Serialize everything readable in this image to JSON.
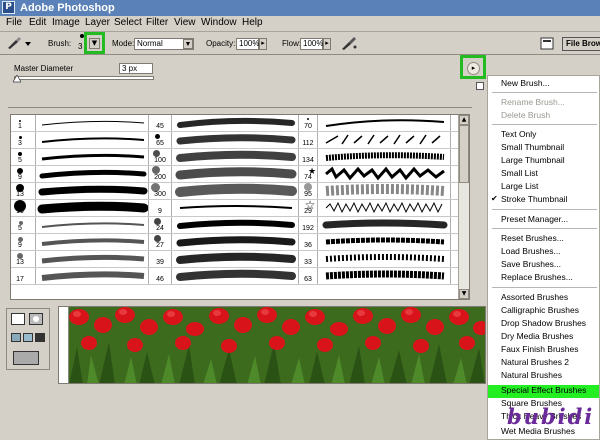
{
  "titlebar": {
    "title": "Adobe Photoshop",
    "app_icon": "ps-icon"
  },
  "menubar": {
    "items": [
      "File",
      "Edit",
      "Image",
      "Layer",
      "Select",
      "Filter",
      "View",
      "Window",
      "Help"
    ]
  },
  "options": {
    "brush_label": "Brush:",
    "brush_size": "3",
    "mode_label": "Mode:",
    "mode_value": "Normal",
    "opacity_label": "Opacity:",
    "opacity_value": "100%",
    "flow_label": "Flow:",
    "flow_value": "100%",
    "file_browser_label": "File Brow"
  },
  "picker": {
    "master_diameter_label": "Master Diameter",
    "master_diameter_value": "3 px",
    "master_diameter_fraction": 0.01
  },
  "brushes": {
    "rows": [
      {
        "a": "1",
        "b": "45",
        "c": "70"
      },
      {
        "a": "3",
        "b": "65",
        "c": "112"
      },
      {
        "a": "5",
        "b": "100",
        "c": "134"
      },
      {
        "a": "9",
        "b": "200",
        "c": "74"
      },
      {
        "a": "13",
        "b": "300",
        "c": "95"
      },
      {
        "a": "19",
        "b": "9",
        "c": "29"
      },
      {
        "a": "5",
        "b": "24",
        "c": "192"
      },
      {
        "a": "9",
        "b": "27",
        "c": "36"
      },
      {
        "a": "13",
        "b": "39",
        "c": "33"
      },
      {
        "a": "17",
        "b": "46",
        "c": "63"
      }
    ]
  },
  "context_menu": {
    "new_brush": "New Brush...",
    "rename_brush": "Rename Brush...",
    "delete_brush": "Delete Brush",
    "text_only": "Text Only",
    "small_thumbnail": "Small Thumbnail",
    "large_thumbnail": "Large Thumbnail",
    "small_list": "Small List",
    "large_list": "Large List",
    "stroke_thumbnail": "Stroke Thumbnail",
    "checkmark": "✔",
    "preset_manager": "Preset Manager...",
    "reset_brushes": "Reset Brushes...",
    "load_brushes": "Load Brushes...",
    "save_brushes": "Save Brushes...",
    "replace_brushes": "Replace Brushes...",
    "assorted": "Assorted Brushes",
    "calligraphic": "Calligraphic Brushes",
    "drop_shadow": "Drop Shadow Brushes",
    "dry_media": "Dry Media Brushes",
    "faux_finish": "Faux Finish Brushes",
    "natural_brushes_2": "Natural Brushes 2",
    "natural_brushes": "Natural Brushes",
    "special_effect": "Special Effect Brushes",
    "square": "Square Brushes",
    "thick_heavy": "Thick Heavy Brushes",
    "wet_media": "Wet Media Brushes"
  },
  "watermark": "bubidi",
  "colors": {
    "highlight": "#22ee22",
    "callout": "#22bb22",
    "title_bar": "#5a82b8"
  }
}
